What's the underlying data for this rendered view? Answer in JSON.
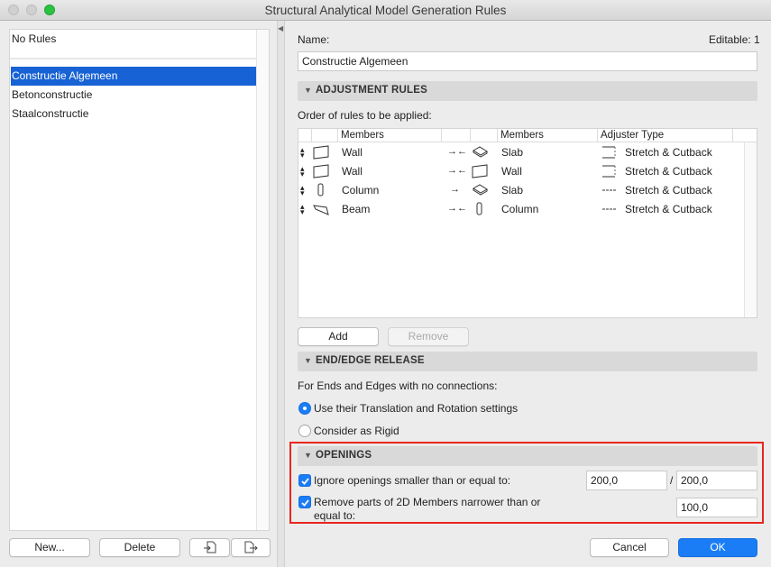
{
  "window": {
    "title": "Structural Analytical Model Generation Rules"
  },
  "left": {
    "no_rules": "No Rules",
    "rules": [
      "Constructie Algemeen",
      "Betonconstructie",
      "Staalconstructie"
    ],
    "new_label": "New...",
    "delete_label": "Delete"
  },
  "header": {
    "name_label": "Name:",
    "editable": "Editable: 1",
    "name_value": "Constructie Algemeen"
  },
  "adjust": {
    "title": "ADJUSTMENT RULES",
    "order_label": "Order of rules to be applied:",
    "columns": [
      "Members",
      "Members",
      "Adjuster Type"
    ],
    "rows": [
      {
        "m1": "Wall",
        "arrow": "→←",
        "m2": "Slab",
        "type": "Stretch & Cutback"
      },
      {
        "m1": "Wall",
        "arrow": "→←",
        "m2": "Wall",
        "type": "Stretch & Cutback"
      },
      {
        "m1": "Column",
        "arrow": "→",
        "m2": "Slab",
        "type": "Stretch & Cutback"
      },
      {
        "m1": "Beam",
        "arrow": "→←",
        "m2": "Column",
        "type": "Stretch & Cutback"
      }
    ],
    "add_label": "Add",
    "remove_label": "Remove"
  },
  "release": {
    "title": "END/EDGE RELEASE",
    "desc": "For Ends and Edges with no connections:",
    "opt1": "Use their Translation and Rotation settings",
    "opt2": "Consider as Rigid"
  },
  "openings": {
    "title": "OPENINGS",
    "ignore_label": "Ignore openings smaller than or equal to:",
    "val1": "200,0",
    "slash": "/",
    "val2": "200,0",
    "remove_label_1": "Remove parts of 2D Members narrower than or",
    "remove_label_2": "equal to:",
    "val3": "100,0"
  },
  "footer": {
    "cancel": "Cancel",
    "ok": "OK"
  },
  "colors": {
    "accent": "#1a7df5",
    "selection": "#1762d4",
    "highlight": "#e8261f",
    "traffic_green": "#2bc142"
  }
}
